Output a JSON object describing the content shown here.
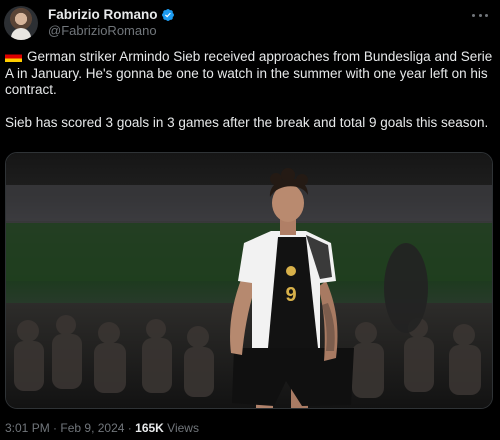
{
  "author": {
    "display_name": "Fabrizio Romano",
    "handle": "@FabrizioRomano"
  },
  "tweet": {
    "paragraphs": [
      "German striker Armindo Sieb received approaches from Bundesliga and Serie A in January. He's gonna be one to watch in the summer with one year left on his contract.",
      "Sieb has scored 3 goals in 3 games after the break and total 9 goals this season."
    ],
    "flag": "germany-flag-icon"
  },
  "media": {
    "jersey_number": "9"
  },
  "meta": {
    "time": "3:01 PM",
    "separator": "·",
    "date": "Feb 9, 2024",
    "views_count": "165K",
    "views_label": "Views"
  },
  "colors": {
    "background": "#000000",
    "text": "#e7e9ea",
    "secondary": "#71767b",
    "verified": "#1d9bf0"
  },
  "icons": [
    "verified-badge-icon",
    "more-options-icon",
    "germany-flag-icon"
  ]
}
